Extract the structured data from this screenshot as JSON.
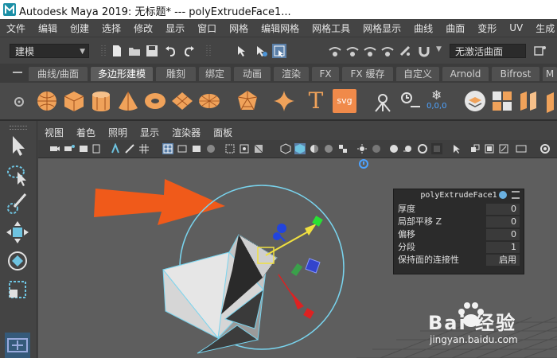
{
  "window": {
    "title": "Autodesk Maya 2019: 无标题*   ---   polyExtrudeFace1..."
  },
  "menubar": {
    "items": [
      "文件",
      "编辑",
      "创建",
      "选择",
      "修改",
      "显示",
      "窗口",
      "网格",
      "编辑网格",
      "网格工具",
      "网格显示",
      "曲线",
      "曲面",
      "变形",
      "UV",
      "生成"
    ]
  },
  "statusline": {
    "mode_value": "建模",
    "live_surface_value": "无激活曲面"
  },
  "shelf_tabs": {
    "items": [
      "曲线/曲面",
      "多边形建模",
      "雕刻",
      "绑定",
      "动画",
      "渲染",
      "FX",
      "FX 缓存",
      "自定义",
      "Arnold",
      "Bifrost",
      "M"
    ],
    "active": "多边形建模"
  },
  "shelf": {
    "text_tool_label": "T",
    "svg_tool_label": "svg",
    "bonus_label": "0,0,0"
  },
  "panel": {
    "menu": [
      "视图",
      "着色",
      "照明",
      "显示",
      "渲染器",
      "面板"
    ]
  },
  "channel_box": {
    "node": "polyExtrudeFace1",
    "attributes": [
      {
        "label": "厚度",
        "value": "0"
      },
      {
        "label": "局部平移 Z",
        "value": "0"
      },
      {
        "label": "偏移",
        "value": "0"
      },
      {
        "label": "分段",
        "value": "1"
      },
      {
        "label": "保持面的连接性",
        "value": "启用"
      }
    ]
  },
  "watermark": {
    "brand": "Bai 经验",
    "url": "jingyan.baidu.com"
  },
  "colors": {
    "accent_orange": "#f05a1a",
    "manipulator_cyan": "#79d4ee",
    "active_tab": "#5d5d5d"
  }
}
